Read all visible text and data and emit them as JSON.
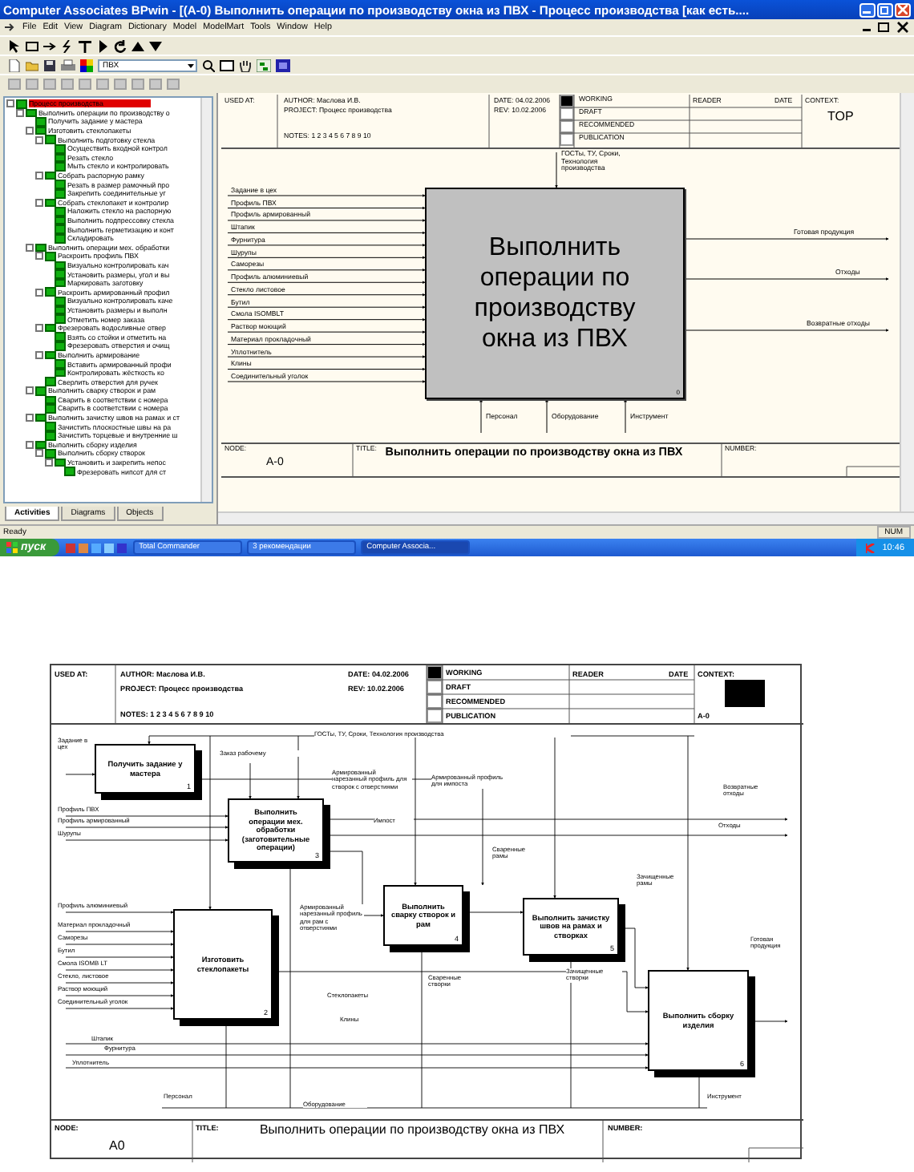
{
  "window": {
    "title": "Computer Associates BPwin - [(A-0) Выполнить  операции  по производству  окна из ПВХ - Процесс производства  [как есть....",
    "menu": [
      "File",
      "Edit",
      "View",
      "Diagram",
      "Dictionary",
      "Model",
      "ModelMart",
      "Tools",
      "Window",
      "Help"
    ],
    "combo": "ПВХ"
  },
  "tree": {
    "items": [
      {
        "label": "Процесс производства",
        "selected": true,
        "children": [
          {
            "label": "Выполнить операции по производству о",
            "selected": false,
            "children": [
              {
                "label": "Получить задание у мастера",
                "selected": false
              },
              {
                "label": "Изготовить стеклопакеты",
                "selected": false,
                "children": [
                  {
                    "label": "Выполнить подготовку стекла",
                    "selected": false,
                    "children": [
                      {
                        "label": "Осуществить входной контрол",
                        "selected": false
                      },
                      {
                        "label": "Резать стекло",
                        "selected": false
                      },
                      {
                        "label": "Мыть стекло и контролировать",
                        "selected": false
                      }
                    ]
                  },
                  {
                    "label": "Собрать распорную рамку",
                    "selected": false,
                    "children": [
                      {
                        "label": "Резать в размер рамочный про",
                        "selected": false
                      },
                      {
                        "label": "Закрепить соединительные уг",
                        "selected": false
                      }
                    ]
                  },
                  {
                    "label": "Собрать стеклопакет и контролир",
                    "selected": false,
                    "children": [
                      {
                        "label": "Наложить стекло на распорную",
                        "selected": false
                      },
                      {
                        "label": "Выполнить подпрессовку стекла",
                        "selected": false
                      },
                      {
                        "label": "Выполнить герметизацию и конт",
                        "selected": false
                      },
                      {
                        "label": "Складировать",
                        "selected": false
                      }
                    ]
                  }
                ]
              },
              {
                "label": "Выполнить операции мех. обработки",
                "selected": false,
                "children": [
                  {
                    "label": "Раскроить профиль ПВХ",
                    "selected": false,
                    "children": [
                      {
                        "label": "Визуально контролировать кач",
                        "selected": false
                      },
                      {
                        "label": "Установить размеры, угол и вы",
                        "selected": false
                      },
                      {
                        "label": "Маркировать заготовку",
                        "selected": false
                      }
                    ]
                  },
                  {
                    "label": "Раскроить армированный профил",
                    "selected": false,
                    "children": [
                      {
                        "label": "Визуально контролировать каче",
                        "selected": false
                      },
                      {
                        "label": "Установить размеры и выполн",
                        "selected": false
                      },
                      {
                        "label": "Отметить номер заказа",
                        "selected": false
                      }
                    ]
                  },
                  {
                    "label": "Фрезеровать водосливные отвер",
                    "selected": false,
                    "children": [
                      {
                        "label": "Взять со стойки и отметить на",
                        "selected": false
                      },
                      {
                        "label": "Фрезеровать отверстия и очищ",
                        "selected": false
                      }
                    ]
                  },
                  {
                    "label": "Выполнить армирование",
                    "selected": false,
                    "children": [
                      {
                        "label": "Вставить армированный профи",
                        "selected": false
                      },
                      {
                        "label": "Контролировать жёсткость ко",
                        "selected": false
                      }
                    ]
                  },
                  {
                    "label": "Сверлить отверстия для ручек",
                    "selected": false
                  }
                ]
              },
              {
                "label": "Выполнить сварку створок и рам",
                "selected": false,
                "children": [
                  {
                    "label": "Сварить в соответствии с номера",
                    "selected": false
                  },
                  {
                    "label": "Сварить в соответствии с номера",
                    "selected": false
                  }
                ]
              },
              {
                "label": "Выполнить зачистку швов на рамах и ст",
                "selected": false,
                "children": [
                  {
                    "label": "Зачистить плоскостные швы на ра",
                    "selected": false
                  },
                  {
                    "label": "Зачистить торцевые и внутренние ш",
                    "selected": false
                  }
                ]
              },
              {
                "label": "Выполнить сборку изделия",
                "selected": false,
                "children": [
                  {
                    "label": "Выполнить сборку створок",
                    "selected": false,
                    "children": [
                      {
                        "label": "Установить и закрепить непос",
                        "selected": false,
                        "children": [
                          {
                            "label": "Фрезеровать нипсот для ст",
                            "selected": false
                          }
                        ]
                      }
                    ]
                  }
                ]
              }
            ]
          }
        ]
      }
    ]
  },
  "panel_tabs": [
    {
      "label": "Activities",
      "selected": true
    },
    {
      "label": "Diagrams",
      "selected": false
    },
    {
      "label": "Objects",
      "selected": false
    }
  ],
  "status_bar": {
    "text": "Ready",
    "indicator": "NUM"
  },
  "taskbar": {
    "start": "пуск",
    "tasks": [
      {
        "label": "Total Commander",
        "selected": false
      },
      {
        "label": "3 рекомендации",
        "selected": false
      },
      {
        "label": "Computer Associa...",
        "selected": true
      }
    ],
    "clock": "10:46"
  },
  "top_diagram": {
    "header": {
      "used_at": "USED AT:",
      "author": "AUTHOR:  Маслова И.В.",
      "project": "PROJECT:  Процесс производства",
      "notes": "NOTES:  1  2  3  4  5  6  7  8  9  10",
      "date": "DATE:  04.02.2006",
      "rev": "REV:    10.02.2006",
      "statuses": [
        {
          "label": "WORKING",
          "selected": true
        },
        {
          "label": "DRAFT",
          "selected": false
        },
        {
          "label": "RECOMMENDED",
          "selected": false
        },
        {
          "label": "PUBLICATION",
          "selected": false
        }
      ],
      "reader": "READER",
      "reader_date": "DATE",
      "context": "CONTEXT:",
      "context_value": "TOP"
    },
    "box": "Выполнить операции по производству окна из ПВХ",
    "box_number": "0",
    "control": "ГОСТы, ТУ, Сроки, Технология производства",
    "inputs": [
      "Задание в цех",
      "Профиль ПВХ",
      "Профиль армированный",
      "Штапик",
      "Фурнитура",
      "Шурупы",
      "Саморезы",
      "Профиль алюминиевый",
      "Стекло  листовое",
      "Бутил",
      "Смола ISOMBLT",
      "Раствор моющий",
      "Материал прокладочный",
      "Уплотнитель",
      "Клины",
      "Соединительный уголок"
    ],
    "outputs": [
      "Готовая продукция",
      "Отходы",
      "Возвратные отходы"
    ],
    "mechanisms": [
      "Персонал",
      "Оборудование",
      "Инструмент"
    ],
    "footer": {
      "node_label": "NODE:",
      "node": "A-0",
      "title_label": "TITLE:",
      "title": "Выполнить  операции  по производству  окна из ПВХ",
      "number_label": "NUMBER:"
    }
  },
  "bottom_diagram": {
    "header": {
      "used_at": "USED AT:",
      "author": "AUTHOR:  Маслова И.В.",
      "project": "PROJECT:  Процесс производства",
      "notes": "NOTES:  1  2  3  4  5  6  7  8  9  10",
      "date": "DATE:  04.02.2006",
      "rev": "REV:    10.02.2006",
      "statuses": [
        {
          "label": "WORKING",
          "selected": true
        },
        {
          "label": "DRAFT",
          "selected": false
        },
        {
          "label": "RECOMMENDED",
          "selected": false
        },
        {
          "label": "PUBLICATION",
          "selected": false
        }
      ],
      "reader": "READER",
      "reader_date": "DATE",
      "context": "CONTEXT:",
      "context_value": "A-0"
    },
    "boxes": [
      {
        "text": "Получить задание у мастера",
        "number": "1"
      },
      {
        "text": "Выполнить операции мех. обработки (заготовительные операции)",
        "number": "3"
      },
      {
        "text": "Изготовить стеклопакеты",
        "number": "2"
      },
      {
        "text": "Выполнить сварку створок и рам",
        "number": "4"
      },
      {
        "text": "Выполнить зачистку швов на рамах и створках",
        "number": "5"
      },
      {
        "text": "Выполнить сборку изделия",
        "number": "6"
      }
    ],
    "labels": [
      "ГОСТы, ТУ, Сроки, Технология производства",
      "Задание в цех",
      "Заказ рабочему",
      "Армированный нарезанный профиль для створок с отверстиями",
      "Армированный профиль для импоста",
      "Возвратные отходы",
      "Отходы",
      "Профиль ПВХ",
      "Профиль армированный",
      "Шурупы",
      "Импост",
      "Сваренные рамы",
      "Зачищенные рамы",
      "Профиль алюминиевый",
      "Армированный нарезанный профиль для рам с отверстиями",
      "Материал прокладочный",
      "Саморезы",
      "Бутил",
      "Смола ISOMB LT",
      "Стекло, листовое",
      "Раствор моющий",
      "Соединительный уголок",
      "Сваренные створки",
      "Зачищенные створки",
      "Готовая продукция",
      "Стеклопакеты",
      "Клины",
      "Штапик",
      "Фурнитура",
      "Уплотнитель",
      "Персонал",
      "Оборудование",
      "Инструмент"
    ],
    "footer": {
      "node_label": "NODE:",
      "node": "A0",
      "title_label": "TITLE:",
      "title": "Выполнить  операции  по производству  окна из ПВХ",
      "number_label": "NUMBER:"
    }
  }
}
